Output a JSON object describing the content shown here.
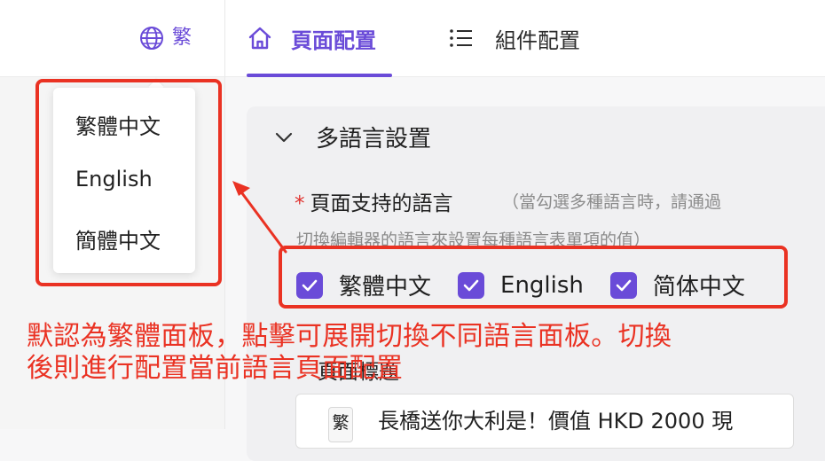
{
  "lang_switcher": {
    "label": "繁"
  },
  "language_menu": {
    "items": [
      "繁體中文",
      "English",
      "簡體中文"
    ]
  },
  "tabs": [
    {
      "label": "頁面配置",
      "active": true,
      "icon": "home-icon"
    },
    {
      "label": "組件配置",
      "active": false,
      "icon": "list-icon"
    }
  ],
  "section": {
    "title": "多語言設置",
    "collapse_icon": "chevron-down-icon"
  },
  "languages_field": {
    "required_mark": "*",
    "label": "頁面支持的語言",
    "hint_line1": "（當勾選多種語言時，請通過",
    "hint_line2": "切換編輯器的語言來設置每種語言表單項的值）",
    "options": [
      {
        "label": "繁體中文",
        "checked": true
      },
      {
        "label": "English",
        "checked": true
      },
      {
        "label": "简体中文",
        "checked": true
      }
    ]
  },
  "page_title_field": {
    "label": "頁面標題",
    "lang_badge": "繁",
    "value": "長橋送你大利是！價值 HKD 2000 現"
  },
  "annotation": {
    "line1": "默認為繁體面板，點擊可展開切換不同語言面板。切換",
    "line2": "後則進行配置當前語言頁面配置"
  },
  "colors": {
    "accent": "#6a4bd8",
    "annotation_red": "#ea3223"
  }
}
